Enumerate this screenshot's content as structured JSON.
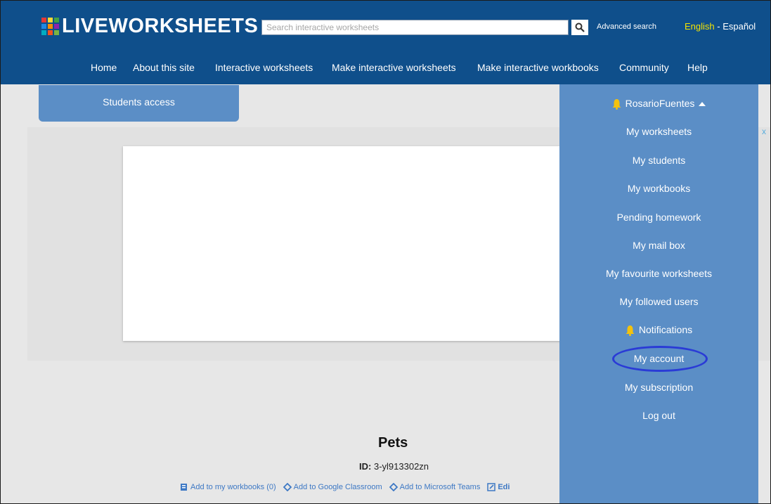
{
  "header": {
    "logo_text": "LIVEWORKSHEETS",
    "logo_colors": [
      "#e53935",
      "#fdd835",
      "#43a047",
      "#1e88e5",
      "#fb8c00",
      "#8e24aa",
      "#00acc1",
      "#f4511e",
      "#7cb342"
    ],
    "search_placeholder": "Search interactive worksheets",
    "search_icon": "search-icon",
    "advanced_search": "Advanced search",
    "lang_english": "English",
    "lang_separator": " - ",
    "lang_spanish": "Español",
    "brand_color": "#0f4f8b"
  },
  "nav": {
    "items": [
      {
        "label": "Home"
      },
      {
        "label": "About this site"
      },
      {
        "label": "Interactive worksheets"
      },
      {
        "label": "Make interactive worksheets"
      },
      {
        "label": "Make interactive workbooks"
      },
      {
        "label": "Community"
      },
      {
        "label": "Help"
      }
    ]
  },
  "students_access": "Students access",
  "worksheet": {
    "title": "Pets",
    "id_label": "ID:",
    "id_value": "3-yl913302zn"
  },
  "actions": [
    {
      "label": "Add to my workbooks (0)",
      "icon": "workbook-icon"
    },
    {
      "label": "Add to Google Classroom",
      "icon": "classroom-icon"
    },
    {
      "label": "Add to Microsoft Teams",
      "icon": "teams-icon"
    },
    {
      "label": "Edi",
      "icon": "edit-icon"
    }
  ],
  "user_menu": {
    "username": "RosarioFuentes",
    "items": [
      {
        "label": "My worksheets"
      },
      {
        "label": "My students"
      },
      {
        "label": "My workbooks"
      },
      {
        "label": "Pending homework"
      },
      {
        "label": "My mail box"
      },
      {
        "label": "My favourite worksheets"
      },
      {
        "label": "My followed users"
      },
      {
        "label": "Notifications"
      },
      {
        "label": "My account"
      },
      {
        "label": "My subscription"
      },
      {
        "label": "Log out"
      }
    ],
    "highlighted": "My account",
    "panel_color": "#5b8ec6",
    "bell_color": "#f4c20d"
  },
  "close_glyph": "x"
}
